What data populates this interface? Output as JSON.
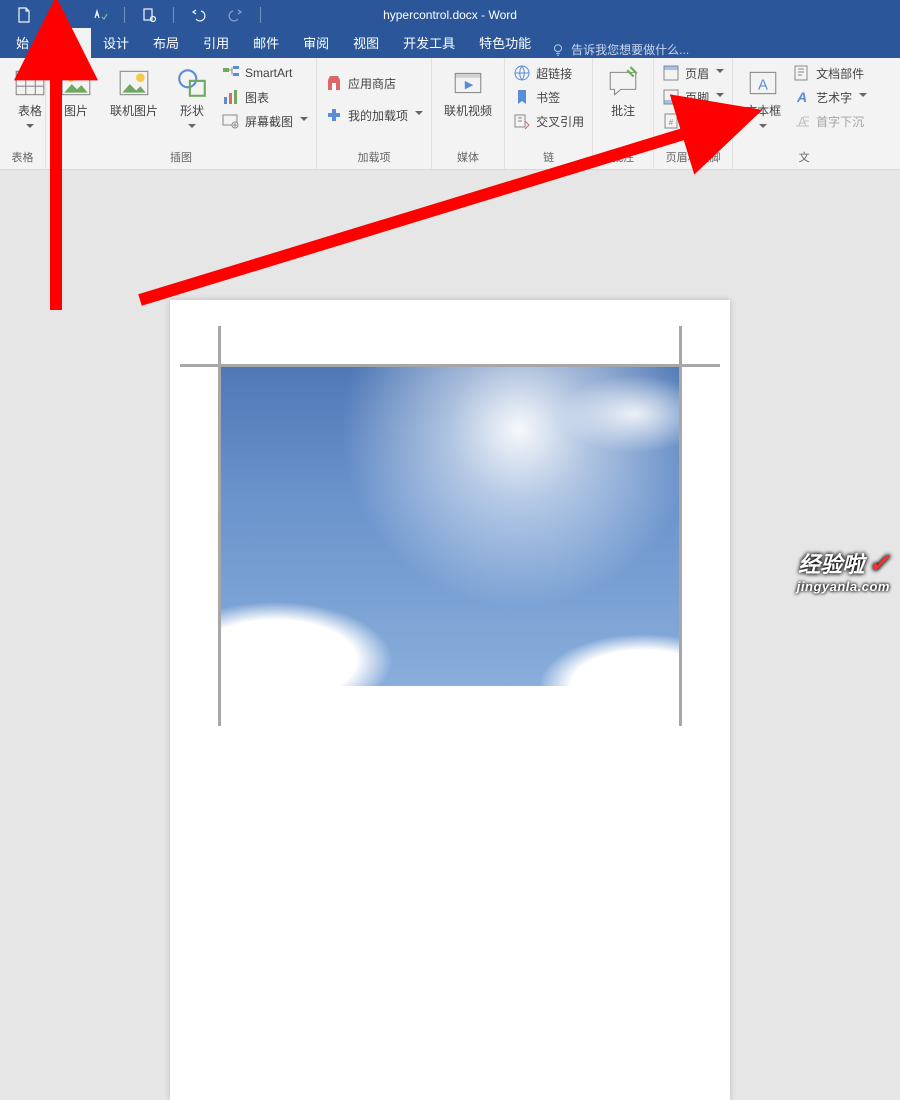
{
  "title": "hypercontrol.docx - Word",
  "tabs": {
    "start": "始",
    "insert": "插入",
    "design": "设计",
    "layout": "布局",
    "references": "引用",
    "mail": "邮件",
    "review": "审阅",
    "view": "视图",
    "dev": "开发工具",
    "special": "特色功能"
  },
  "tellme_placeholder": "告诉我您想要做什么...",
  "groups": {
    "tables": {
      "label": "表格",
      "btn": "表格"
    },
    "illustrations": {
      "label": "插图",
      "picture": "图片",
      "online_pic": "联机图片",
      "shapes": "形状",
      "smartart": "SmartArt",
      "chart": "图表",
      "screenshot": "屏幕截图"
    },
    "addins": {
      "label": "加载项",
      "store": "应用商店",
      "myaddins": "我的加载项"
    },
    "media": {
      "label": "媒体",
      "video": "联机视频"
    },
    "links": {
      "label": "链",
      "hyperlink": "超链接",
      "bookmark": "书签",
      "crossref": "交叉引用"
    },
    "comments": {
      "label": "批注",
      "btn": "批注"
    },
    "headerfooter": {
      "label": "页眉和页脚",
      "header": "页眉",
      "footer": "页脚",
      "pagenum": "页"
    },
    "text": {
      "label": "文",
      "textbox": "文本框",
      "parts": "文档部件",
      "wordart": "艺术字",
      "dropcap": "首字下沉"
    }
  },
  "watermark": {
    "line1": "经验啦",
    "line2": "jingyanla.com"
  }
}
